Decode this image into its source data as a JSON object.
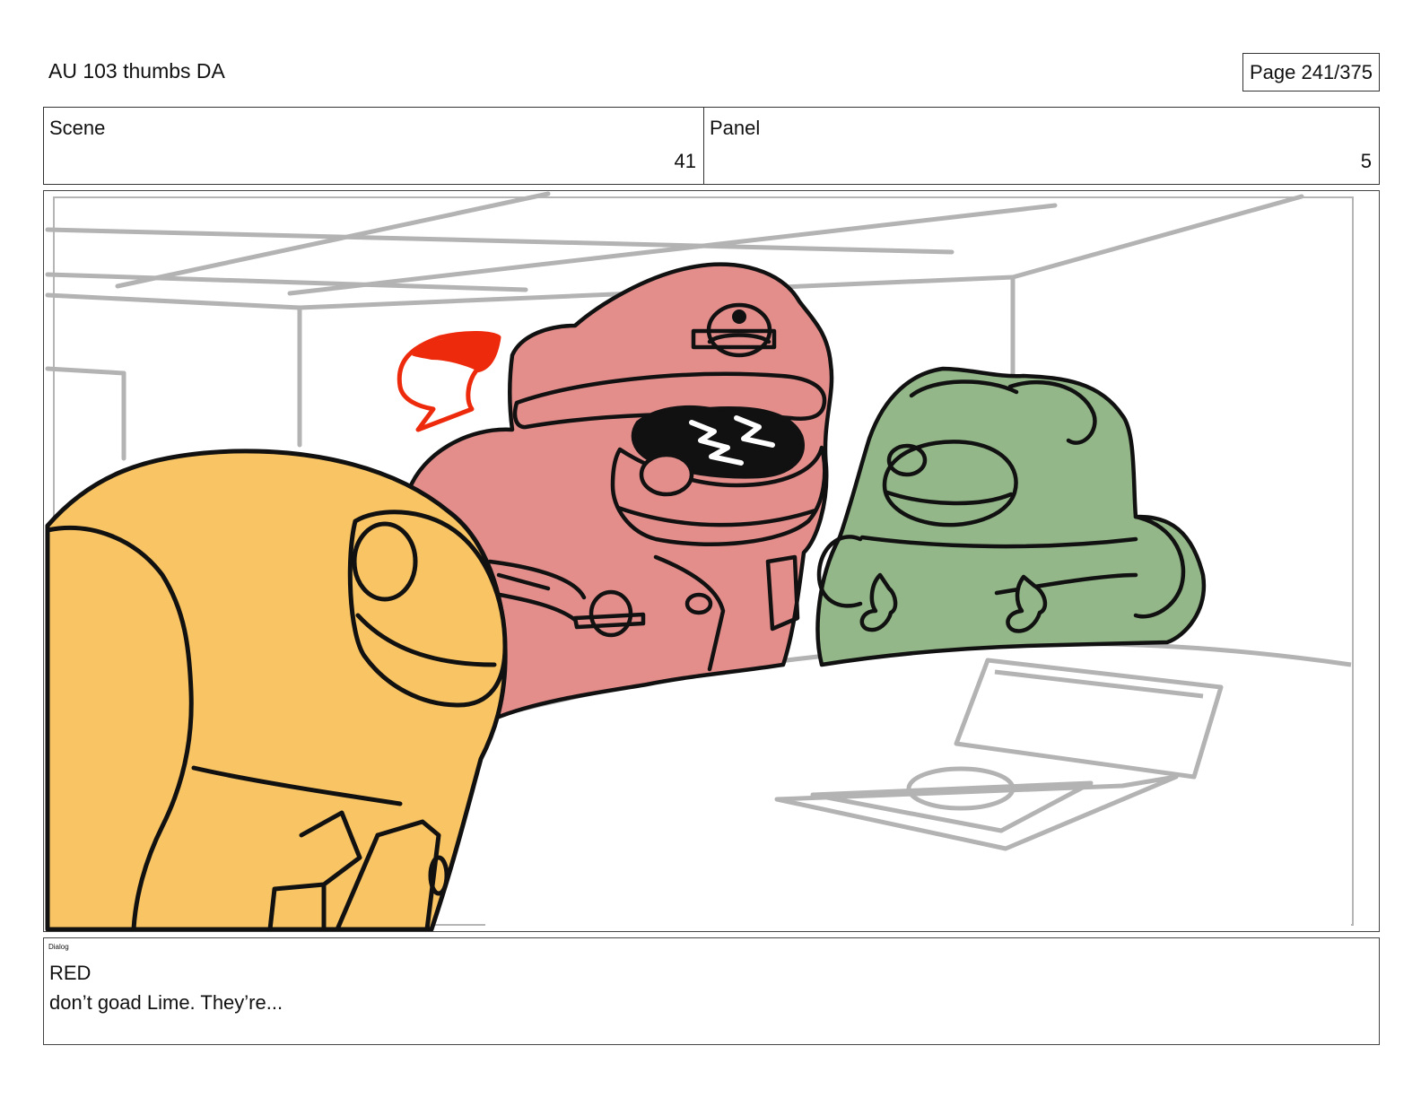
{
  "header": {
    "title": "AU 103 thumbs DA",
    "page_label": "Page 241/375"
  },
  "info": {
    "scene_label": "Scene",
    "scene_value": "41",
    "panel_label": "Panel",
    "panel_value": "5"
  },
  "artwork": {
    "characters": [
      "yellow-crewmate",
      "red-crewmate",
      "green-crewmate"
    ],
    "colors": {
      "yellow": "#f9c463",
      "red": "#e48e8c",
      "green": "#93b788",
      "speech_mark": "#ee2a0c",
      "background_lines": "#b5b5b5",
      "outline": "#111111"
    }
  },
  "dialog": {
    "caption": "Dialog",
    "speaker": "RED",
    "line": "don’t goad Lime. They’re..."
  }
}
